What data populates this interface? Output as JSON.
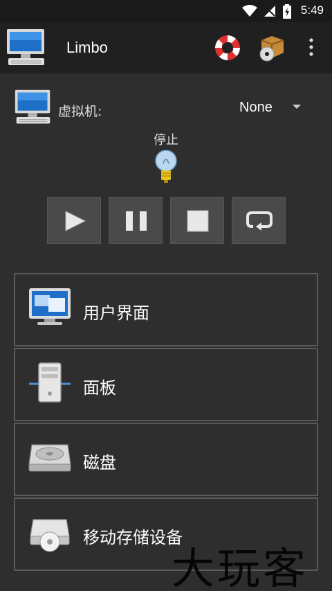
{
  "status_bar": {
    "time": "5:49"
  },
  "app_bar": {
    "title": "Limbo"
  },
  "vm": {
    "label": "虚拟机:",
    "selected": "None"
  },
  "machine_status": "停止",
  "controls": [
    {
      "name": "play-button",
      "icon": "play-icon"
    },
    {
      "name": "pause-button",
      "icon": "pause-icon"
    },
    {
      "name": "stop-button",
      "icon": "stop-icon"
    },
    {
      "name": "restart-button",
      "icon": "restart-icon"
    }
  ],
  "menu": [
    {
      "label": "用户界面",
      "icon": "monitor-ui-icon"
    },
    {
      "label": "面板",
      "icon": "server-tower-icon"
    },
    {
      "label": "磁盘",
      "icon": "hard-disk-icon"
    },
    {
      "label": "移动存储设备",
      "icon": "cd-drive-icon"
    }
  ],
  "watermark": "大玩客",
  "colors": {
    "background": "#2e2e2e",
    "app_bar": "#202020",
    "button": "#4a4a4a",
    "border": "#5a5a5a"
  }
}
